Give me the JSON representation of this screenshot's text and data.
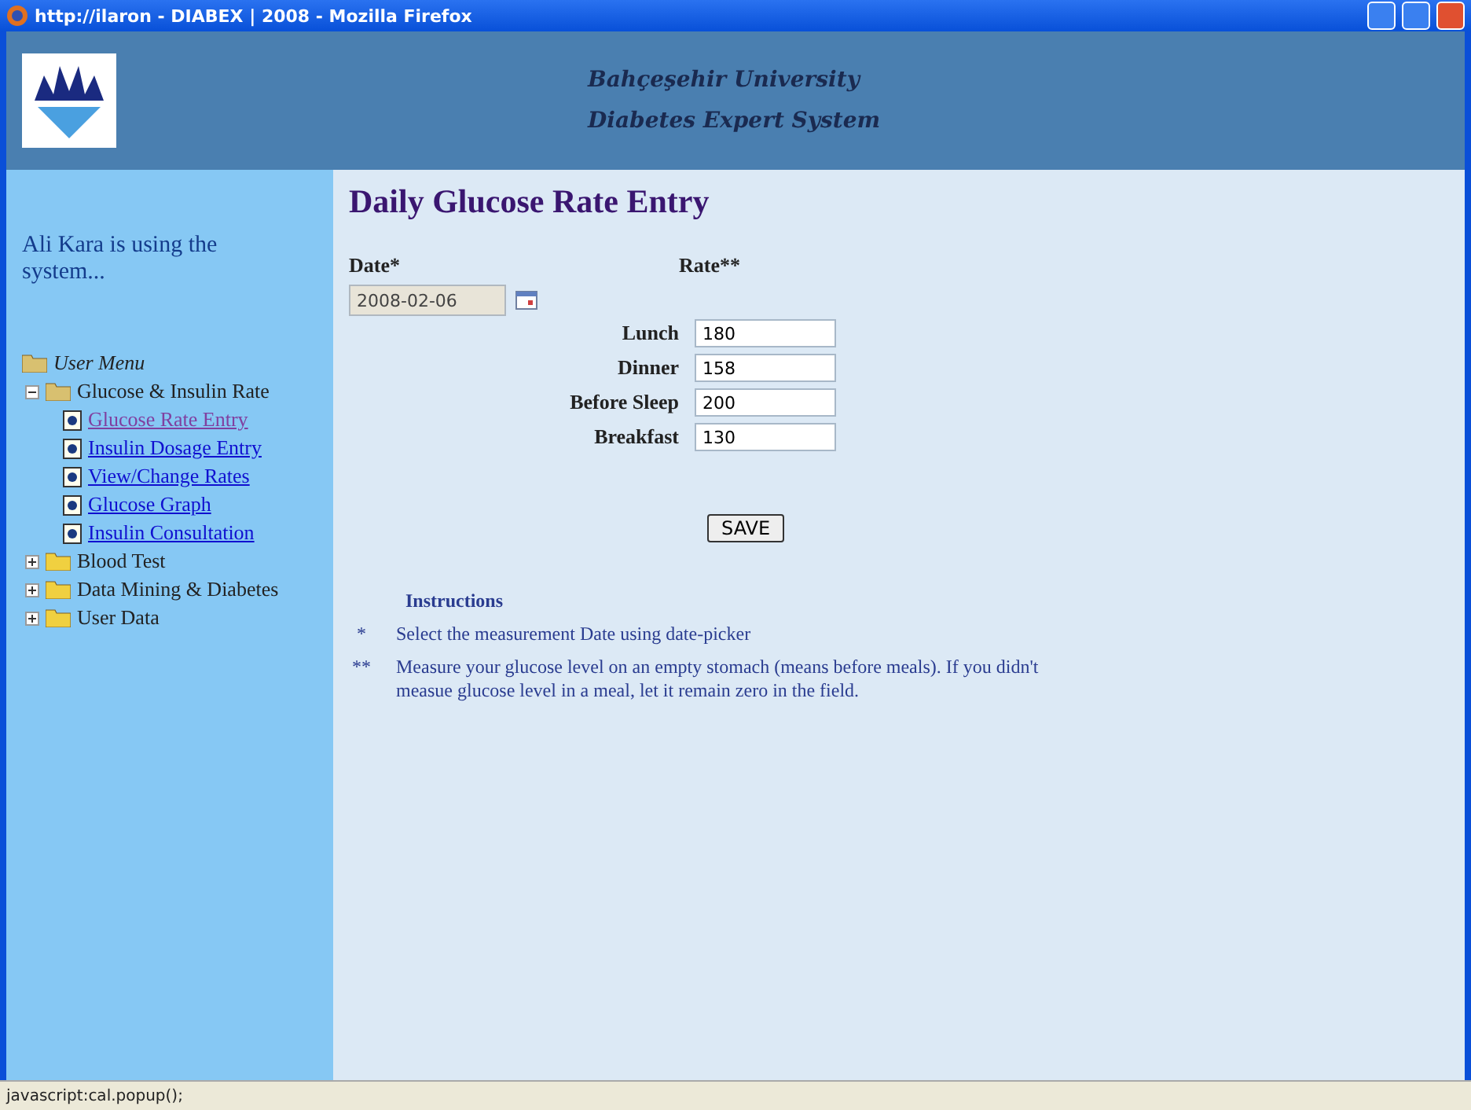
{
  "window": {
    "title": "http://ilaron - DIABEX | 2008 - Mozilla Firefox"
  },
  "header": {
    "lines": [
      "Bahçeşehir University",
      "Diabetes Expert System"
    ]
  },
  "sidebar": {
    "user_text": "Ali Kara is using the system...",
    "menu": {
      "label": "User Menu",
      "children": [
        {
          "label": "Glucose & Insulin Rate",
          "expanded": true,
          "children": [
            {
              "label": "Glucose Rate Entry",
              "visited": true
            },
            {
              "label": "Insulin Dosage Entry",
              "visited": false
            },
            {
              "label": "View/Change Rates",
              "visited": false
            },
            {
              "label": "Glucose Graph",
              "visited": false
            },
            {
              "label": "Insulin Consultation",
              "visited": false
            }
          ]
        },
        {
          "label": "Blood Test",
          "expanded": false
        },
        {
          "label": "Data Mining & Diabetes",
          "expanded": false
        },
        {
          "label": "User Data",
          "expanded": false
        }
      ]
    }
  },
  "form": {
    "title": "Daily Glucose Rate Entry",
    "date_label": "Date*",
    "rate_label": "Rate**",
    "date_value": "2008-02-06",
    "rates": [
      {
        "label": "Lunch",
        "value": "180"
      },
      {
        "label": "Dinner",
        "value": "158"
      },
      {
        "label": "Before Sleep",
        "value": "200"
      },
      {
        "label": "Breakfast",
        "value": "130"
      }
    ],
    "save": "SAVE"
  },
  "instructions": {
    "title": "Instructions",
    "items": [
      {
        "mark": "*",
        "text": "Select the measurement Date using date-picker"
      },
      {
        "mark": "**",
        "text": "Measure your glucose level on an empty stomach (means before meals). If you didn't measue glucose level in a meal, let it remain zero in the field."
      }
    ]
  },
  "status_bar": "javascript:cal.popup();"
}
